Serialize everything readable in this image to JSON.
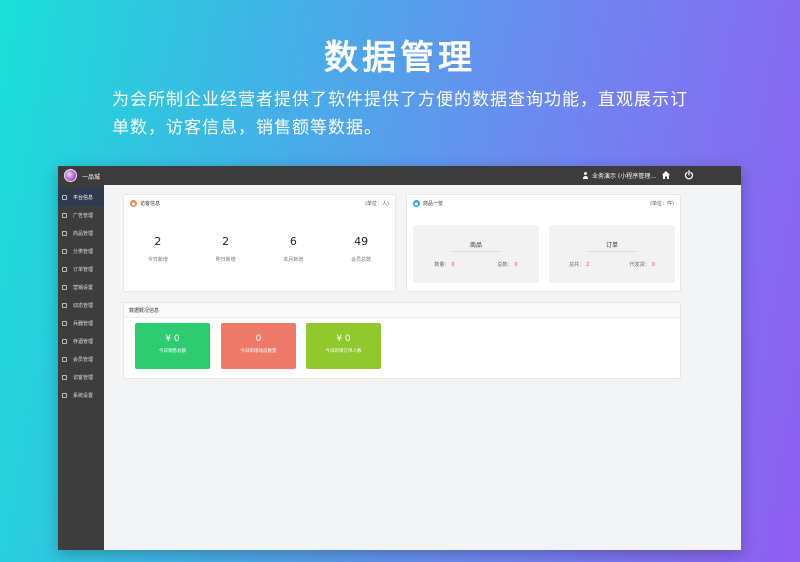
{
  "hero": {
    "title": "数据管理",
    "description": "为会所制企业经营者提供了软件提供了方便的数据查询功能，直观展示订单数，访客信息，销售额等数据。"
  },
  "topbar": {
    "app_name": "一品城",
    "user_label": "业务演示 (小程序管理...",
    "home_icon": "home-icon",
    "power_icon": "power-icon"
  },
  "sidebar": {
    "items": [
      {
        "label": "平台信息",
        "icon": "info-icon",
        "active": true
      },
      {
        "label": "广告管理",
        "icon": "ad-icon"
      },
      {
        "label": "商品管理",
        "icon": "goods-icon"
      },
      {
        "label": "分类管理",
        "icon": "category-icon"
      },
      {
        "label": "订单管理",
        "icon": "order-icon"
      },
      {
        "label": "营销设置",
        "icon": "marketing-icon"
      },
      {
        "label": "动态管理",
        "icon": "feed-icon"
      },
      {
        "label": "兵器管理",
        "icon": "tool-icon"
      },
      {
        "label": "存酒管理",
        "icon": "wine-icon"
      },
      {
        "label": "会员管理",
        "icon": "member-icon"
      },
      {
        "label": "访客管理",
        "icon": "visitor-icon"
      },
      {
        "label": "系统设置",
        "icon": "settings-icon"
      }
    ]
  },
  "visitors": {
    "title": "访客信息",
    "unit": "(单位：人)",
    "stats": [
      {
        "value": "2",
        "label": "今日新增"
      },
      {
        "value": "2",
        "label": "昨日新增"
      },
      {
        "value": "6",
        "label": "本月新增"
      },
      {
        "value": "49",
        "label": "会员总数"
      }
    ]
  },
  "products": {
    "title": "商品一览",
    "unit": "(单位：件)",
    "goods": {
      "title": "商品",
      "left_label": "数量：",
      "left_value": "0",
      "right_label": "总数：",
      "right_value": "0"
    },
    "orders": {
      "title": "订单",
      "left_label": "总共：",
      "left_value": "2",
      "right_label": "代发货：",
      "right_value": "0"
    }
  },
  "overview": {
    "title": "数据概况信息",
    "tiles": [
      {
        "value": "¥ 0",
        "label": "今日销售总额",
        "color": "#2ecc71"
      },
      {
        "value": "0",
        "label": "今日新增动态数量",
        "color": "#f07a6a"
      },
      {
        "value": "¥ 0",
        "label": "今日新增订单人数",
        "color": "#8fc92e"
      }
    ]
  }
}
